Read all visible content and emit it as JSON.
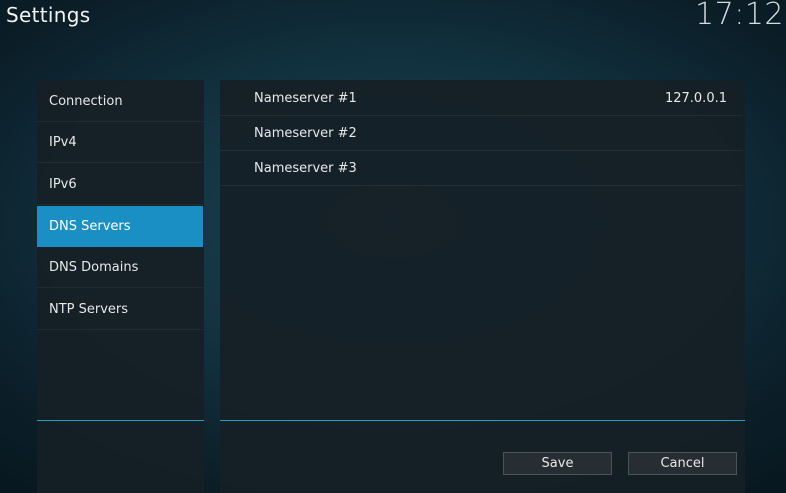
{
  "header": {
    "title": "Settings",
    "clock": "17:12"
  },
  "sidebar": {
    "items": [
      {
        "label": "Connection"
      },
      {
        "label": "IPv4"
      },
      {
        "label": "IPv6"
      },
      {
        "label": "DNS Servers",
        "selected": true
      },
      {
        "label": "DNS Domains"
      },
      {
        "label": "NTP Servers"
      }
    ]
  },
  "main": {
    "rows": [
      {
        "label": "Nameserver #1",
        "value": "127.0.0.1"
      },
      {
        "label": "Nameserver #2",
        "value": ""
      },
      {
        "label": "Nameserver #3",
        "value": ""
      }
    ],
    "buttons": {
      "save": "Save",
      "cancel": "Cancel"
    }
  },
  "colors": {
    "accent": "#1a8fc3",
    "panel": "#161f26",
    "background": "#123240"
  }
}
